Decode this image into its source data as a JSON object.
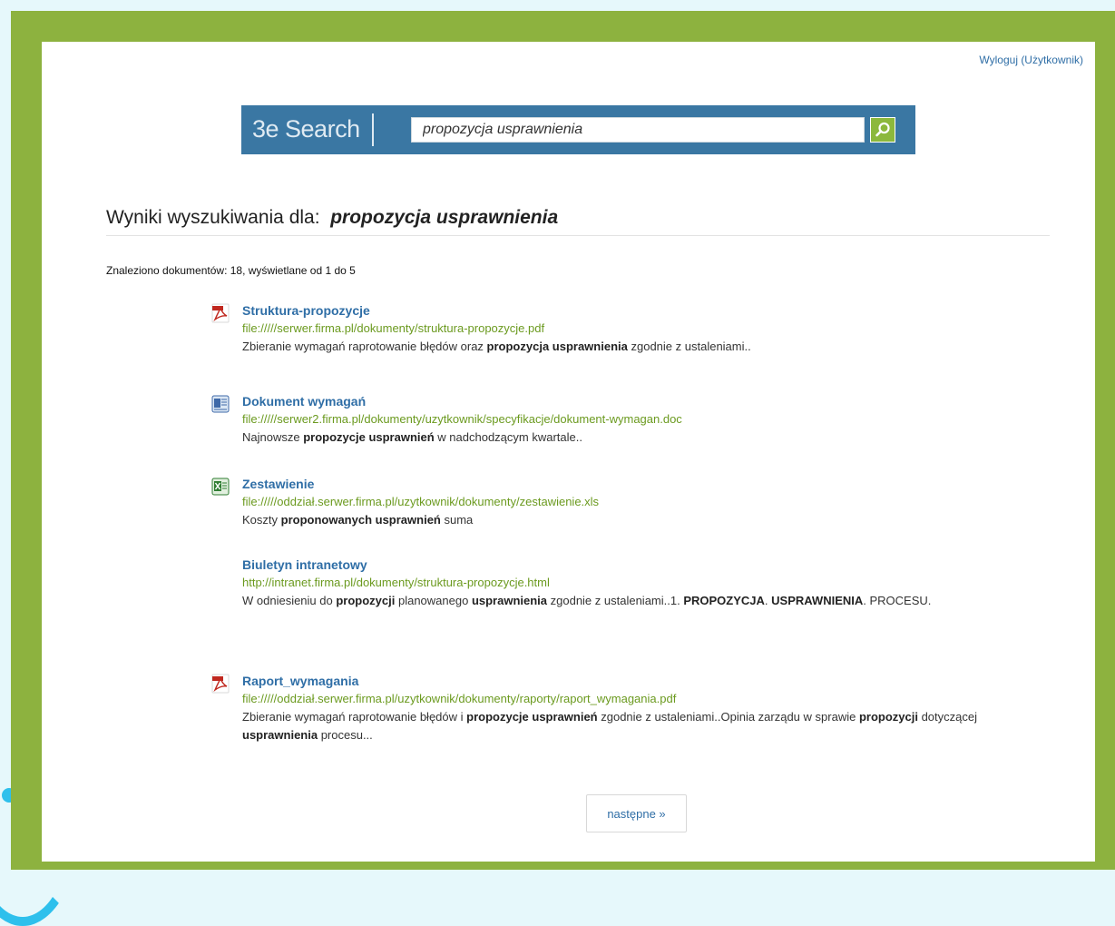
{
  "header": {
    "logout_label": "Wyloguj (Użytkownik)"
  },
  "search": {
    "brand": "3e Search",
    "query": "propozycja usprawnienia",
    "button_icon": "search-icon"
  },
  "results": {
    "heading_prefix": "Wyniki wyszukiwania dla:",
    "heading_query": "propozycja usprawnienia",
    "summary": "Znaleziono dokumentów: 18, wyświetlane od 1 do 5",
    "items": [
      {
        "icon": "pdf-icon",
        "title": "Struktura-propozycje",
        "url": "file://///serwer.firma.pl/dokumenty/struktura-propozycje.pdf",
        "snippet": [
          {
            "t": "Zbieranie wymagań raprotowanie błędów oraz ",
            "b": false
          },
          {
            "t": "propozycja usprawnienia",
            "b": true
          },
          {
            "t": " zgodnie z ustaleniami..",
            "b": false
          }
        ]
      },
      {
        "icon": "word-icon",
        "title": "Dokument wymagań",
        "url": "file://///serwer2.firma.pl/dokumenty/uzytkownik/specyfikacje/dokument-wymagan.doc",
        "snippet": [
          {
            "t": "Najnowsze ",
            "b": false
          },
          {
            "t": "propozycje usprawnień",
            "b": true
          },
          {
            "t": " w nadchodzącym kwartale..",
            "b": false
          }
        ]
      },
      {
        "icon": "excel-icon",
        "title": "Zestawienie",
        "url": "file://///oddział.serwer.firma.pl/uzytkownik/dokumenty/zestawienie.xls",
        "snippet": [
          {
            "t": "Koszty ",
            "b": false
          },
          {
            "t": "proponowanych usprawnień",
            "b": true
          },
          {
            "t": " suma",
            "b": false
          }
        ]
      },
      {
        "icon": "",
        "title": "Biuletyn intranetowy",
        "url": "http://intranet.firma.pl/dokumenty/struktura-propozycje.html",
        "snippet": [
          {
            "t": "W odniesieniu do ",
            "b": false
          },
          {
            "t": "propozycji",
            "b": true
          },
          {
            "t": " planowanego ",
            "b": false
          },
          {
            "t": "usprawnienia",
            "b": true
          },
          {
            "t": " zgodnie z ustaleniami..1. ",
            "b": false
          },
          {
            "t": "PROPOZYCJA",
            "b": true
          },
          {
            "t": ". ",
            "b": false
          },
          {
            "t": "USPRAWNIENIA",
            "b": true
          },
          {
            "t": ". PROCESU.",
            "b": false
          }
        ]
      },
      {
        "icon": "pdf-icon",
        "title": "Raport_wymagania",
        "url": "file://///oddział.serwer.firma.pl/uzytkownik/dokumenty/raporty/raport_wymagania.pdf",
        "snippet": [
          {
            "t": "Zbieranie wymagań raprotowanie błędów i ",
            "b": false
          },
          {
            "t": "propozycje usprawnień",
            "b": true
          },
          {
            "t": " zgodnie z ustaleniami..Opinia zarządu w sprawie ",
            "b": false
          },
          {
            "t": "propozycji",
            "b": true
          },
          {
            "t": " dotyczącej ",
            "b": false
          },
          {
            "t": "usprawnienia",
            "b": true
          },
          {
            "t": " procesu...",
            "b": false
          }
        ]
      }
    ]
  },
  "pagination": {
    "next_label": "następne »"
  },
  "colors": {
    "frame": "#8db23f",
    "search_bar": "#3a77a3",
    "link": "#2f6ea6",
    "url": "#6b9a1f",
    "search_button": "#8cb83c",
    "decoration": "#2ec0ec"
  }
}
